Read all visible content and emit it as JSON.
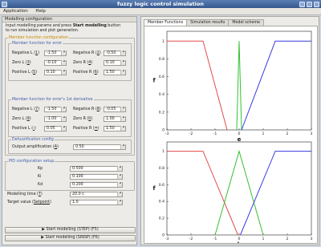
{
  "window": {
    "title": "fuzzy logic control simulation"
  },
  "menu": {
    "items": [
      "Application",
      "Help"
    ]
  },
  "left": {
    "header": "Modelling configuration",
    "intro1": "Input modelling params and press ",
    "intro_bold": "Start modelling",
    "intro2": " button",
    "intro3": "to run simulation and plot generation.",
    "mf_title": "Member function configuration",
    "error_title": "Member function for error",
    "neg_l": "Negative L (",
    "neg_l_key": "1",
    "neg_l_val": "-1.50",
    "neg_r": "Negative R (",
    "neg_r_key": "2",
    "neg_r_val": "-0.50",
    "zero_l": "Zero L (",
    "zero_l_key": "3",
    "zero_l_val": "-0.10",
    "zero_r": "Zero R (",
    "zero_r_key": "4",
    "zero_r_val": "0.10",
    "pos_l": "Positive L (",
    "pos_l_key": "5",
    "pos_l_val": "0.10",
    "pos_r": "Positive R (",
    "pos_r_key": "6",
    "pos_r_val": "1.50",
    "deriv_title": "Member function for error's 1st derivative",
    "dneg_l": "Negative L (",
    "dneg_l_key": "7",
    "dneg_l_val": "-1.50",
    "dneg_r": "Negative R (",
    "dneg_r_key": "8",
    "dneg_r_val": "-0.05",
    "dzero_l": "Zero L (",
    "dzero_l_key": "9",
    "dzero_l_val": "-1.00",
    "dzero_r": "Zero R (",
    "dzero_r_key": "0",
    "dzero_r_val": "1.00",
    "dpos_l": "Positive L (",
    "dpos_l_key": "-",
    "dpos_l_val": "0.05",
    "dpos_r": "Positive R (",
    "dpos_r_key": "=",
    "dpos_r_val": "1.50",
    "defuzz_title": "Defuzzification config",
    "out_amp": "Output amplification (",
    "out_amp_key": "A",
    "out_amp_val": "0.50",
    "pid_title": "PID configuration setup",
    "kp": "Kp",
    "kp_val": "0.500",
    "ki": "Ki",
    "ki_val": "0.100",
    "kd": "Kd",
    "kd_val": "0.200",
    "time_lbl": "Modelling time (",
    "time_key": "T",
    "time_val": "20.0 c",
    "target_lbl": "Target value (",
    "target_key": "Setpoint",
    "target_val": "1.0",
    "btn_step": "▶  Start modelling (STEP) (F5)",
    "btn_sinsp": "▶  Start modelling (SINSP) (F6)"
  },
  "tabs": [
    "Member Functions",
    "Simulation results",
    "Model scheme"
  ],
  "chart_data": [
    {
      "type": "line",
      "xlabel": "e",
      "ylabel": "f",
      "xlim": [
        -3,
        3
      ],
      "ylim": [
        0,
        1
      ],
      "xticks": [
        "-3",
        "-2",
        "-1",
        "0",
        "1",
        "2",
        "3"
      ],
      "yticks": [
        "0",
        "0.2",
        "0.4",
        "0.6",
        "0.8",
        "1"
      ],
      "series": [
        {
          "color": "#e14b4b",
          "x": [
            -3,
            -1.5,
            -0.5
          ],
          "y": [
            1,
            1,
            0
          ]
        },
        {
          "color": "#33c233",
          "x": [
            -0.1,
            0,
            0.1
          ],
          "y": [
            0,
            1,
            0
          ]
        },
        {
          "color": "#3b3be0",
          "x": [
            0.1,
            1.5,
            3
          ],
          "y": [
            0,
            1,
            1
          ]
        }
      ]
    },
    {
      "type": "line",
      "xlabel": "de",
      "ylabel": "f",
      "xlim": [
        -3,
        3
      ],
      "ylim": [
        0,
        1
      ],
      "xticks": [
        "-3",
        "-2",
        "-1",
        "0",
        "1",
        "2",
        "3"
      ],
      "yticks": [
        "0",
        "0.2",
        "0.4",
        "0.6",
        "0.8",
        "1"
      ],
      "series": [
        {
          "color": "#e14b4b",
          "x": [
            -3,
            -1.5,
            -0.05
          ],
          "y": [
            1,
            1,
            0
          ]
        },
        {
          "color": "#33c233",
          "x": [
            -1,
            0,
            1
          ],
          "y": [
            0,
            1,
            0
          ]
        },
        {
          "color": "#3b3be0",
          "x": [
            0.05,
            1.5,
            3
          ],
          "y": [
            0,
            1,
            1
          ]
        }
      ]
    }
  ]
}
